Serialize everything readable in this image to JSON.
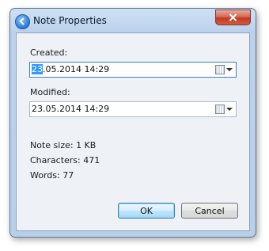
{
  "window": {
    "title": "Note Properties",
    "close_symbol": "✕",
    "app_icon": "back-arrow-circle-icon"
  },
  "fields": {
    "created": {
      "label": "Created:",
      "value_selected": "23",
      "value_rest": ".05.2014 14:29"
    },
    "modified": {
      "label": "Modified:",
      "value": "23.05.2014 14:29"
    }
  },
  "info": {
    "note_size": "Note size: 1 KB",
    "characters": "Characters: 471",
    "words": "Words: 77"
  },
  "buttons": {
    "ok": "OK",
    "cancel": "Cancel"
  },
  "colors": {
    "accent": "#3399ff",
    "close_red": "#c23a23",
    "frame": "#bcd2ec"
  }
}
